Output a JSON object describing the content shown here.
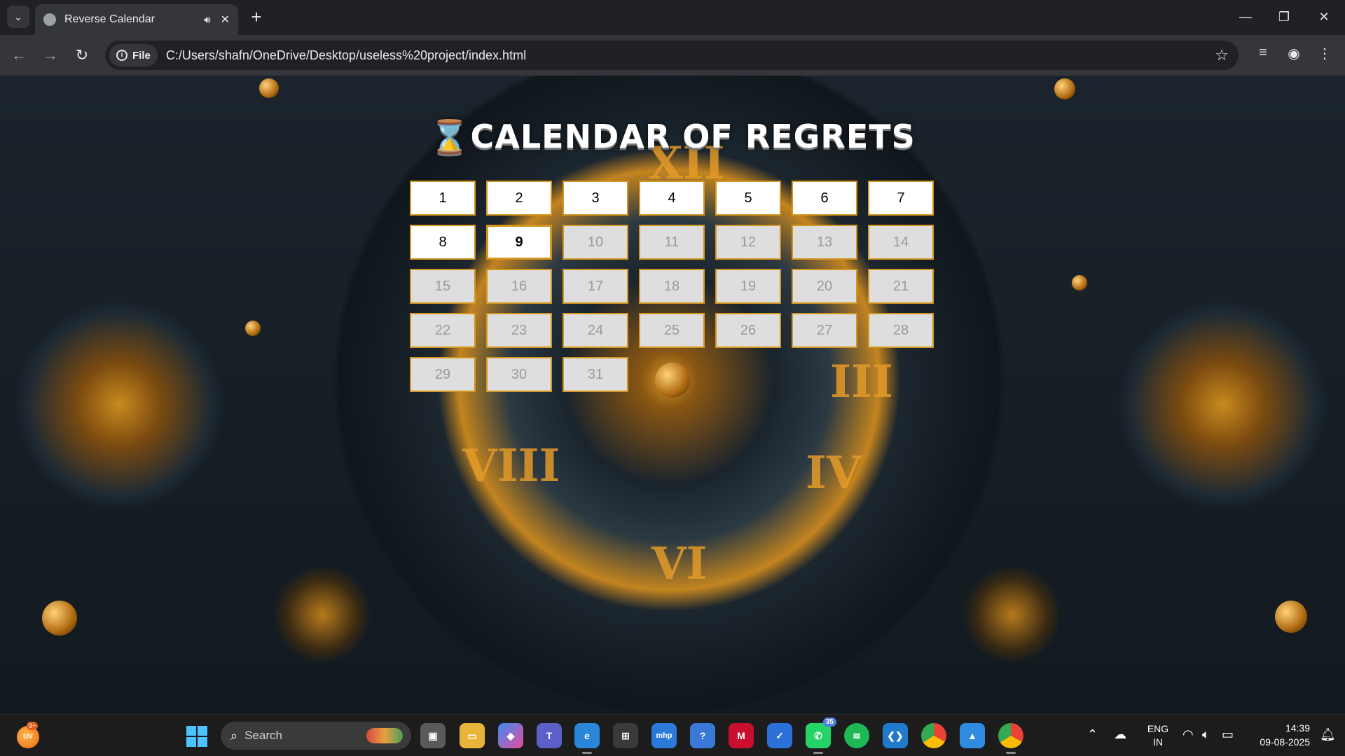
{
  "browser": {
    "tab_title": "Reverse Calendar",
    "site_label": "File",
    "url": "C:/Users/shafn/OneDrive/Desktop/useless%20project/index.html"
  },
  "page": {
    "title": "⌛CALENDAR OF REGRETS",
    "today": 9,
    "days_past": [
      1,
      2,
      3,
      4,
      5,
      6,
      7,
      8
    ],
    "days_future": [
      10,
      11,
      12,
      13,
      14,
      15,
      16,
      17,
      18,
      19,
      20,
      21,
      22,
      23,
      24,
      25,
      26,
      27,
      28,
      29,
      30,
      31
    ],
    "colors": {
      "accent": "#d4961f",
      "past_bg": "#ffffff",
      "future_bg": "#dedede"
    }
  },
  "taskbar": {
    "weather_badge": "9+",
    "search_label": "Search",
    "whatsapp_badge": "35",
    "language": "ENG",
    "region": "IN",
    "time": "14:39",
    "date": "09-08-2025"
  }
}
